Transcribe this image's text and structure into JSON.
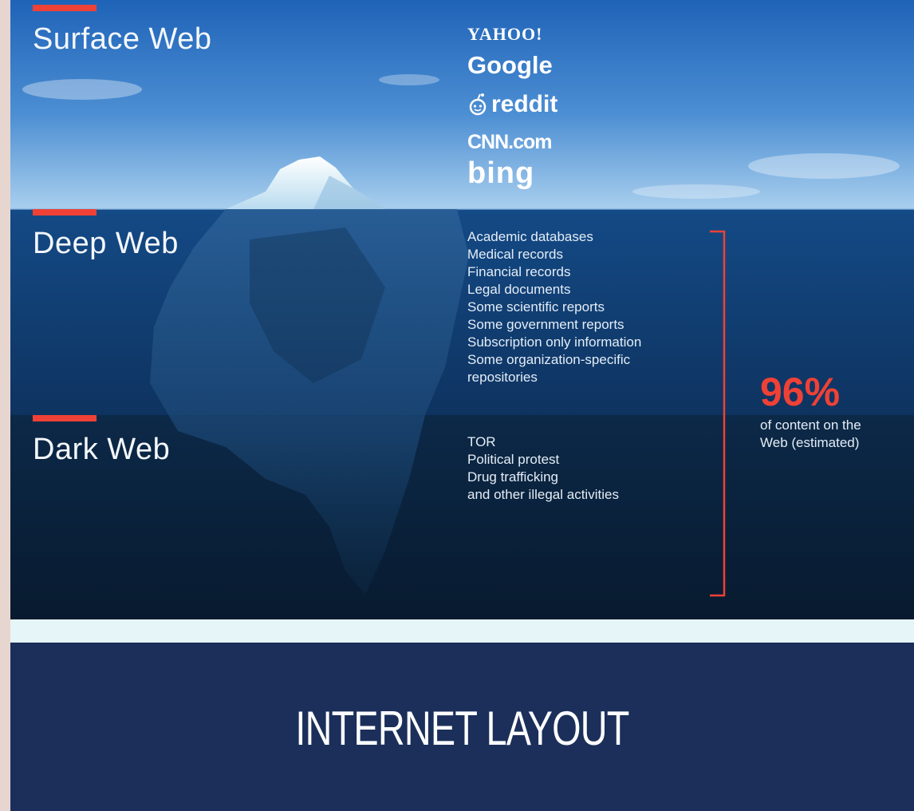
{
  "colors": {
    "accent": "#ef4136",
    "sky_top": "#1f63b8",
    "sky_bottom": "#9ec7ea",
    "deep_water": "#0f3b6e",
    "dark_water": "#0a2038",
    "footer": "#1b2f5a",
    "band": "#e6f5f8"
  },
  "sections": {
    "surface": {
      "title": "Surface Web",
      "logos": {
        "yahoo": "YAHOO!",
        "google": "Google",
        "reddit": "reddit",
        "cnn": "CNN.com",
        "bing": "bing"
      }
    },
    "deep": {
      "title": "Deep Web",
      "items": [
        "Academic databases",
        "Medical records",
        "Financial records",
        "Legal documents",
        "Some scientific reports",
        "Some government reports",
        "Subscription only information",
        "Some organization-specific",
        "repositories"
      ]
    },
    "dark": {
      "title": "Dark Web",
      "items": [
        "TOR",
        "Political protest",
        "Drug trafficking",
        "and other illegal activities"
      ]
    }
  },
  "stat": {
    "value": "96%",
    "caption_line1": "of content on the",
    "caption_line2": "Web (estimated)"
  },
  "footer": {
    "title": "INTERNET LAYOUT"
  }
}
